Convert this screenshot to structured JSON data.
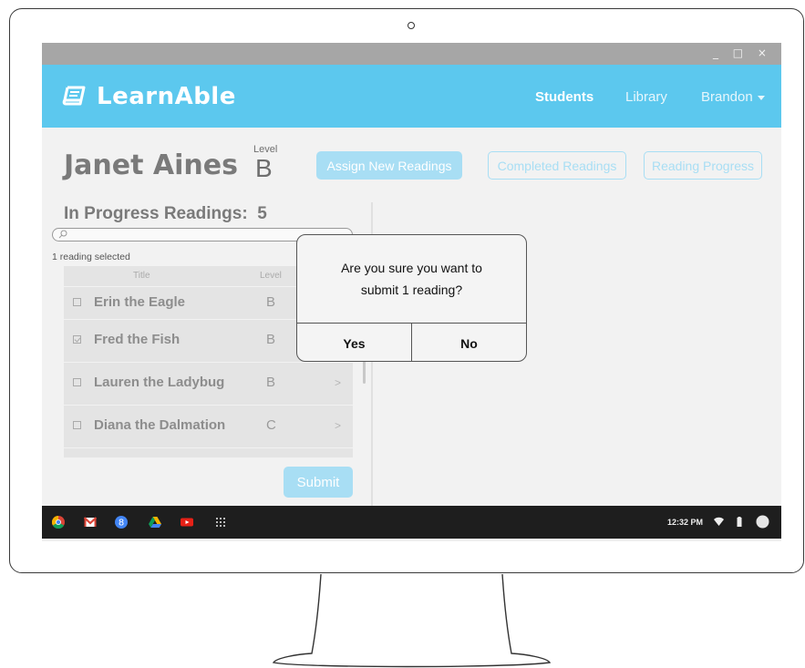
{
  "window": {
    "controls": "_ □ ×"
  },
  "app": {
    "name": "LearnAble",
    "nav": {
      "students": "Students",
      "library": "Library",
      "user": "Brandon"
    }
  },
  "student": {
    "name": "Janet Aines",
    "level_caption": "Level",
    "level": "B"
  },
  "tabs": {
    "assign": "Assign New Readings",
    "completed": "Completed Readings",
    "progress": "Reading Progress"
  },
  "readings": {
    "heading": "In Progress Readings:",
    "count": "5",
    "search_placeholder": "",
    "selected_text": "1 reading selected",
    "columns": {
      "title": "Title",
      "level": "Level"
    },
    "rows": [
      {
        "title": "Erin the Eagle",
        "level": "B",
        "checked": false,
        "chevron": ""
      },
      {
        "title": "Fred the Fish",
        "level": "B",
        "checked": true,
        "chevron": ""
      },
      {
        "title": "Lauren the Ladybug",
        "level": "B",
        "checked": false,
        "chevron": ">"
      },
      {
        "title": "Diana the Dalmation",
        "level": "C",
        "checked": false,
        "chevron": ">"
      }
    ],
    "submit": "Submit"
  },
  "dialog": {
    "message": "Are you sure you want to submit 1 reading?",
    "yes": "Yes",
    "no": "No"
  },
  "taskbar": {
    "apps": [
      "chrome-icon",
      "gmail-icon",
      "google-plus-icon",
      "drive-icon",
      "youtube-icon",
      "apps-grid-icon"
    ],
    "clock": "12:32 PM"
  },
  "colors": {
    "accent": "#5cc8ee",
    "accent_light": "#a8def4",
    "taskbar": "#1e1e1e"
  }
}
